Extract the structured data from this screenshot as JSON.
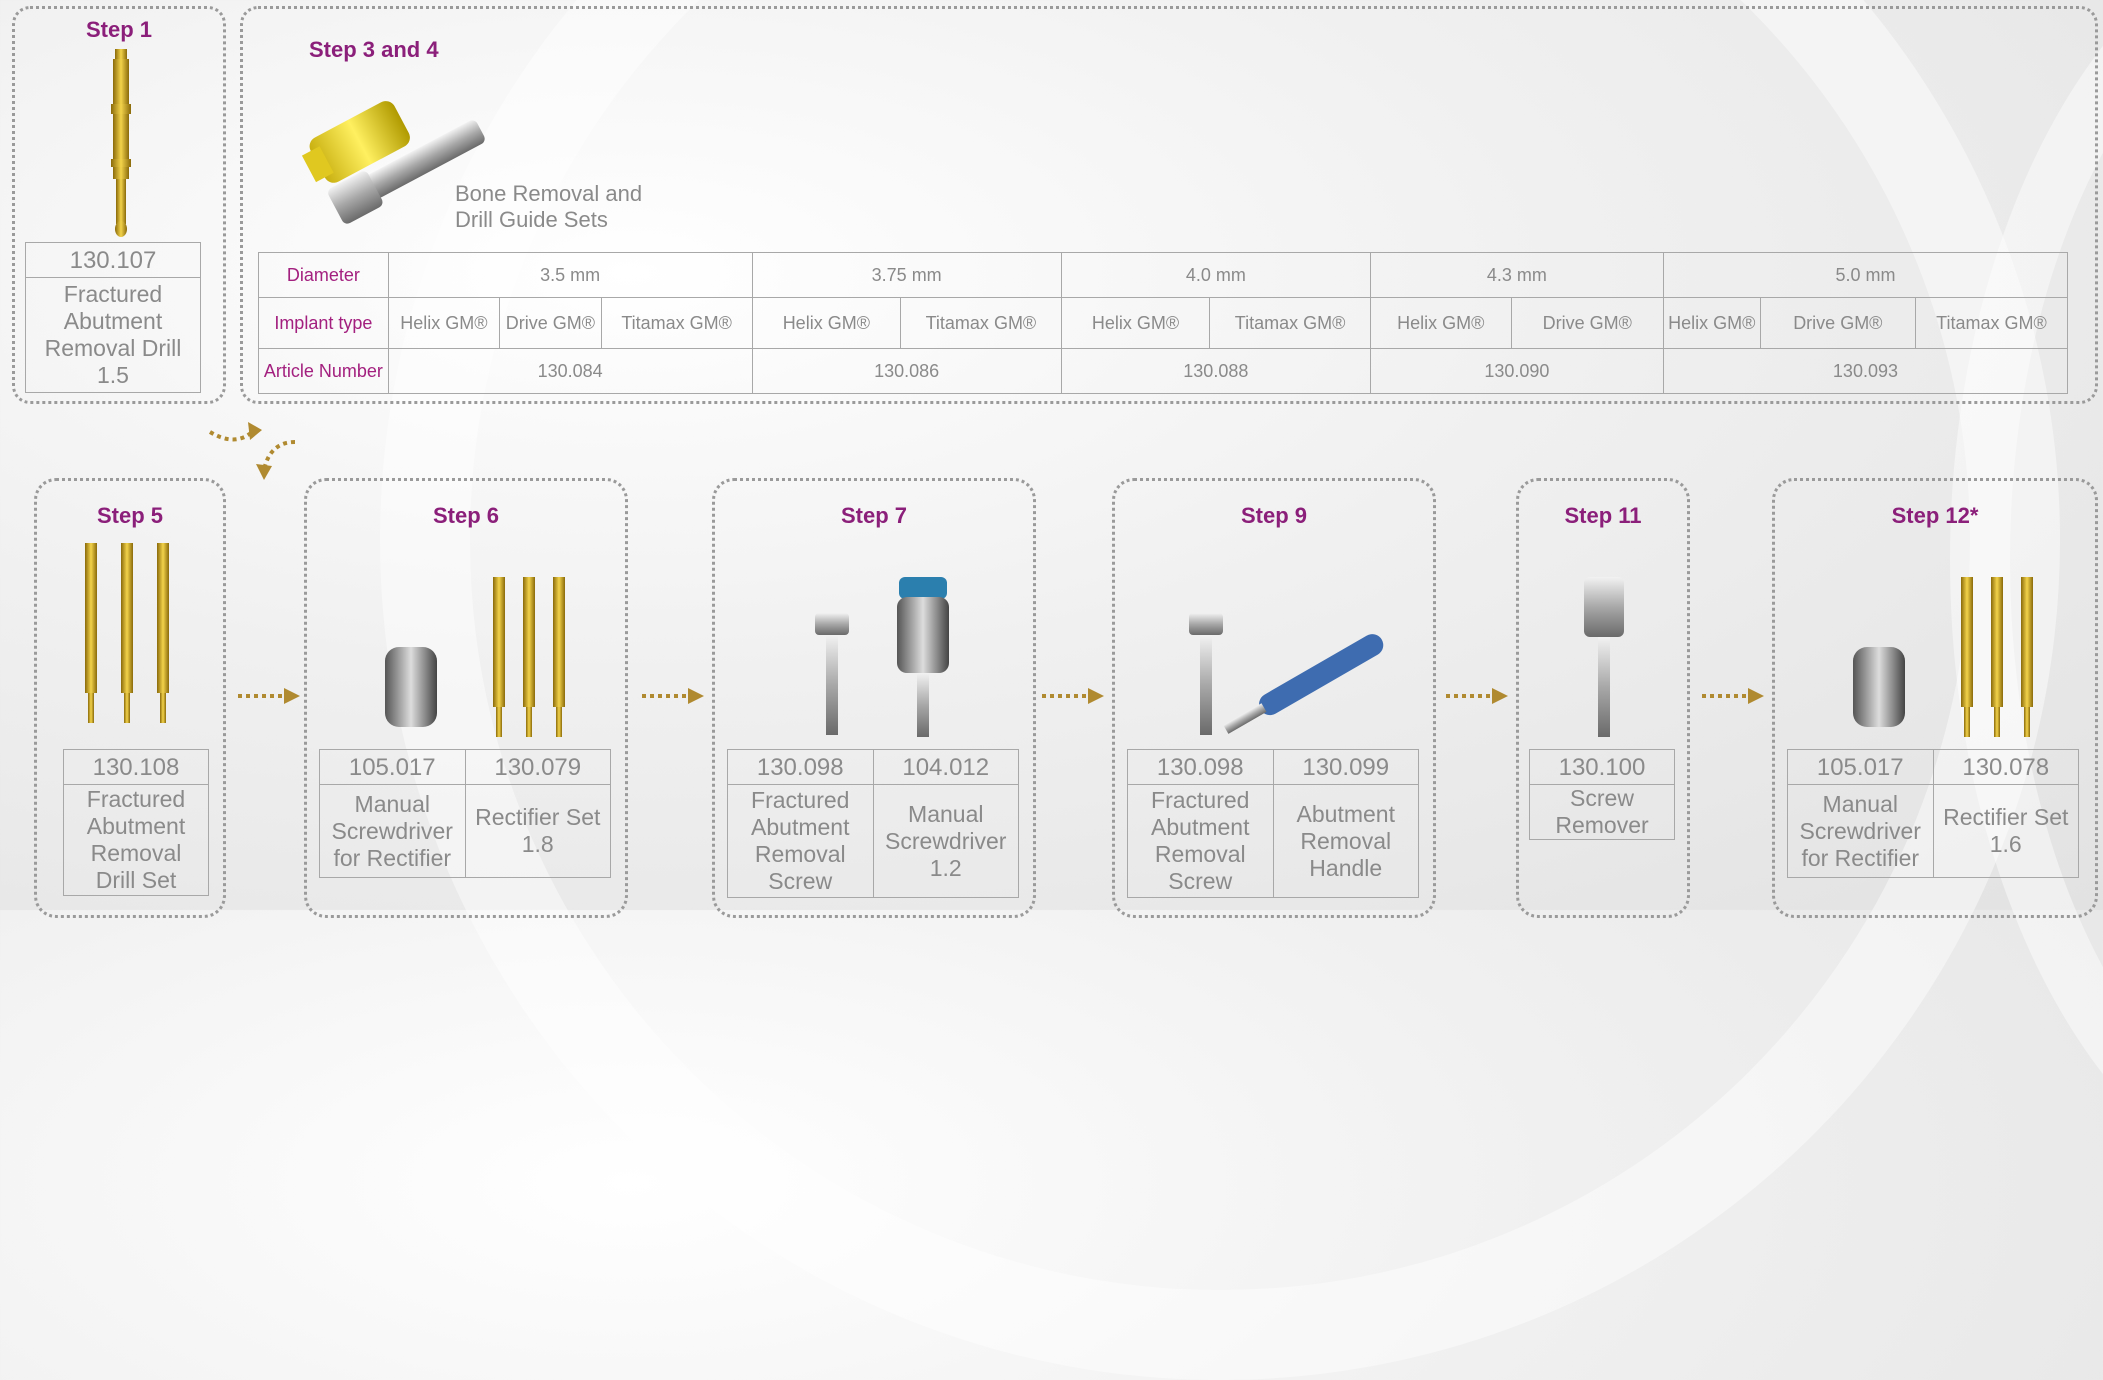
{
  "step1": {
    "title": "Step 1",
    "number": "130.107",
    "label": "Fractured Abutment Removal Drill 1.5"
  },
  "step34": {
    "title": "Step 3 and 4",
    "caption_line1": "Bone Removal and",
    "caption_line2": "Drill Guide Sets",
    "row_labels": {
      "diameter": "Diameter",
      "implant_type": "Implant type",
      "article": "Article Number"
    },
    "diameters": [
      "3.5 mm",
      "3.75 mm",
      "4.0 mm",
      "4.3 mm",
      "5.0 mm"
    ],
    "implants": [
      "Helix GM®",
      "Drive GM®",
      "Titamax GM®",
      "Helix GM®",
      "Titamax GM®",
      "Helix GM®",
      "Titamax GM®",
      "Helix GM®",
      "Drive GM®",
      "Helix GM®",
      "Drive GM®",
      "Titamax GM®"
    ],
    "articles": [
      "130.084",
      "130.086",
      "130.088",
      "130.090",
      "130.093"
    ]
  },
  "step5": {
    "title": "Step 5",
    "number": "130.108",
    "label": "Fractured Abutment Removal Drill Set"
  },
  "step6": {
    "title": "Step 6",
    "items": [
      {
        "number": "105.017",
        "label": "Manual Screwdriver for Rectifier"
      },
      {
        "number": "130.079",
        "label": "Rectifier Set 1.8"
      }
    ]
  },
  "step7": {
    "title": "Step 7",
    "items": [
      {
        "number": "130.098",
        "label": "Fractured Abutment Removal Screw"
      },
      {
        "number": "104.012",
        "label": "Manual Screwdriver 1.2"
      }
    ]
  },
  "step9": {
    "title": "Step 9",
    "items": [
      {
        "number": "130.098",
        "label": "Fractured Abutment Removal Screw"
      },
      {
        "number": "130.099",
        "label": "Abutment Removal Handle"
      }
    ]
  },
  "step11": {
    "title": "Step 11",
    "number": "130.100",
    "label": "Screw Remover"
  },
  "step12": {
    "title": "Step 12*",
    "items": [
      {
        "number": "105.017",
        "label": "Manual Screwdriver for Rectifier"
      },
      {
        "number": "130.078",
        "label": "Rectifier Set 1.6"
      }
    ]
  },
  "colors": {
    "accent": "#8b1f7a",
    "gold": "#c9a21e",
    "text": "#8a8a8a",
    "border": "#a8a8a8"
  }
}
